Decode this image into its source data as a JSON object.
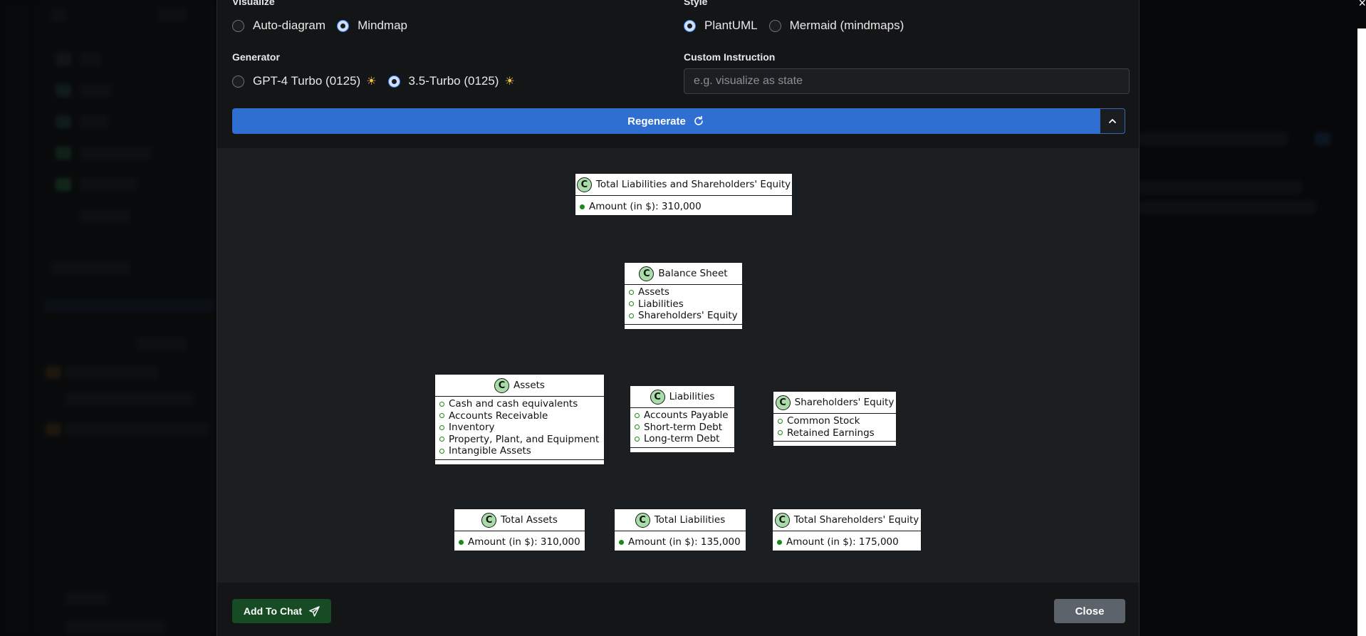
{
  "visualize": {
    "label": "Visualize",
    "options": [
      {
        "label": "Auto-diagram",
        "selected": false
      },
      {
        "label": "Mindmap",
        "selected": true
      }
    ]
  },
  "style": {
    "label": "Style",
    "options": [
      {
        "label": "PlantUML",
        "selected": true
      },
      {
        "label": "Mermaid (mindmaps)",
        "selected": false
      }
    ]
  },
  "generator": {
    "label": "Generator",
    "options": [
      {
        "label": "GPT-4 Turbo (0125)",
        "icon": "sun-icon",
        "selected": false
      },
      {
        "label": "3.5-Turbo (0125)",
        "icon": "sun-icon",
        "selected": true
      }
    ]
  },
  "custom_instruction": {
    "label": "Custom Instruction",
    "placeholder": "e.g. visualize as state",
    "value": ""
  },
  "regenerate": {
    "label": "Regenerate",
    "icon": "refresh-icon",
    "toggle_icon": "chevron-up-icon"
  },
  "diagram": {
    "badge": "C",
    "classes": {
      "total_lse": {
        "title": "Total Liabilities and Shareholders' Equity",
        "fields": [
          "Amount (in $): 310,000"
        ]
      },
      "balance_sheet": {
        "title": "Balance Sheet",
        "methods": [
          "Assets",
          "Liabilities",
          "Shareholders' Equity"
        ]
      },
      "assets": {
        "title": "Assets",
        "methods": [
          "Cash and cash equivalents",
          "Accounts Receivable",
          "Inventory",
          "Property, Plant, and Equipment",
          "Intangible Assets"
        ]
      },
      "liabilities": {
        "title": "Liabilities",
        "methods": [
          "Accounts Payable",
          "Short-term Debt",
          "Long-term Debt"
        ]
      },
      "shareholders_equity": {
        "title": "Shareholders' Equity",
        "methods": [
          "Common Stock",
          "Retained Earnings"
        ]
      },
      "total_assets": {
        "title": "Total Assets",
        "fields": [
          "Amount (in $): 310,000"
        ]
      },
      "total_liabilities": {
        "title": "Total Liabilities",
        "fields": [
          "Amount (in $): 135,000"
        ]
      },
      "total_se": {
        "title": "Total Shareholders' Equity",
        "fields": [
          "Amount (in $): 175,000"
        ]
      }
    }
  },
  "footer": {
    "add_to_chat": {
      "label": "Add To Chat",
      "icon": "send-icon"
    },
    "close": {
      "label": "Close"
    }
  },
  "colors": {
    "primary": "#2f6fd1",
    "success": "#164b24",
    "secondary": "#5c636a",
    "class_badge": "#a9dca9"
  }
}
